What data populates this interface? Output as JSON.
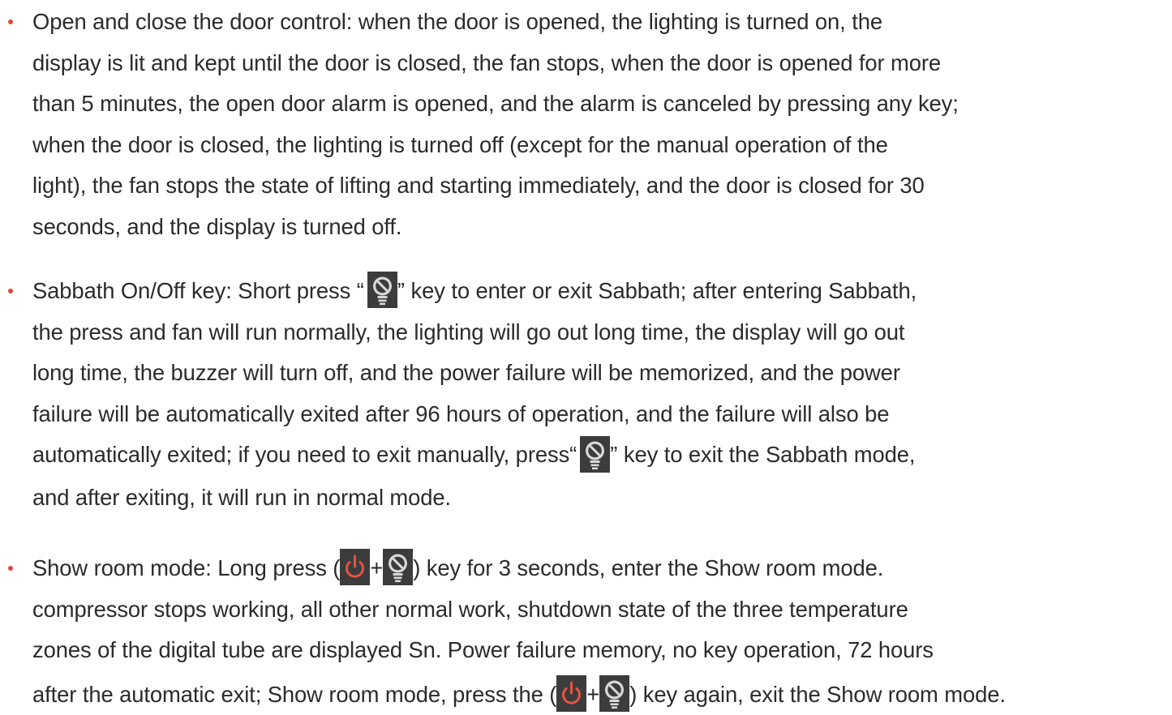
{
  "items": [
    {
      "lines": [
        "Open and close the door control: when the door is opened, the lighting is turned on, the",
        "display is lit and kept until the door is closed, the fan stops, when the door is opened for more",
        "than 5 minutes, the open door alarm is opened, and the alarm is canceled by pressing any key;",
        "when the door is closed, the lighting is turned off (except for the manual operation of the",
        "light), the fan stops the state of lifting and starting immediately, and the door is closed for 30",
        "seconds, and the display is turned off."
      ]
    },
    {
      "l1a": "Sabbath On/Off key: Short press ",
      "l1q1": "“",
      "l1q2": "”",
      "l1b": " key to enter or exit Sabbath; after entering Sabbath,",
      "l2": "the press and fan will run normally, the lighting will go out long time, the display will go out",
      "l3": "long time, the buzzer will turn off, and the power failure will be memorized, and the power",
      "l4": "failure will be automatically exited after 96 hours of operation, and the failure will also be",
      "l5a": "automatically exited; if you need to exit manually, press",
      "l5q1": "“",
      "l5q2": "”",
      "l5b": " key to exit the Sabbath mode,",
      "l6": "and after exiting, it will run in normal mode."
    },
    {
      "l1a": "Show room mode: Long press (",
      "l1plus": "+",
      "l1b": ") key for 3 seconds, enter the Show room mode.",
      "l2": "compressor stops working, all other normal work, shutdown state of the three temperature",
      "l3": "zones of the digital tube are displayed Sn. Power failure memory, no key operation, 72 hours",
      "l4a": "after the automatic exit; Show room mode, press the (",
      "l4plus": "+",
      "l4b": ") key again, exit the Show room mode."
    }
  ],
  "icons": {
    "sabbath": "sabbath-light-icon",
    "power": "power-icon"
  },
  "colors": {
    "text": "#2b2b2b",
    "bullet": "#e0463a",
    "key_bg": "#3c3c3c",
    "power": "#e8533f",
    "bulb": "#d8d8d8"
  }
}
